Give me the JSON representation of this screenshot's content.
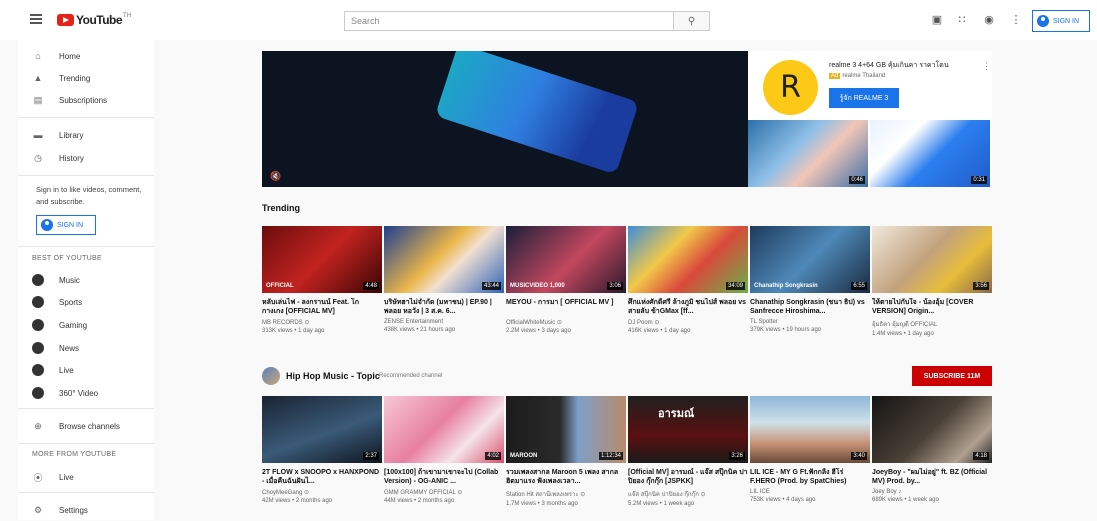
{
  "header": {
    "logo_text": "YouTube",
    "logo_sup": "TH",
    "search_placeholder": "Search",
    "sign_in": "SIGN IN"
  },
  "sidebar": {
    "items_top": [
      {
        "label": "Home",
        "icon": "home-icon"
      },
      {
        "label": "Trending",
        "icon": "flame-icon"
      },
      {
        "label": "Subscriptions",
        "icon": "subscriptions-icon"
      }
    ],
    "items_lib": [
      {
        "label": "Library",
        "icon": "folder-icon"
      },
      {
        "label": "History",
        "icon": "history-icon"
      }
    ],
    "signin_prompt": "Sign in to like videos, comment, and subscribe.",
    "signin_button": "SIGN IN",
    "best_heading": "BEST OF YOUTUBE",
    "best_items": [
      {
        "label": "Music",
        "icon": "music-icon"
      },
      {
        "label": "Sports",
        "icon": "sports-icon"
      },
      {
        "label": "Gaming",
        "icon": "gaming-icon"
      },
      {
        "label": "News",
        "icon": "news-icon"
      },
      {
        "label": "Live",
        "icon": "live-icon"
      },
      {
        "label": "360° Video",
        "icon": "360-icon"
      }
    ],
    "browse_channels": "Browse channels",
    "more_heading": "MORE FROM YOUTUBE",
    "more_items": [
      {
        "label": "Live",
        "icon": "broadcast-icon"
      },
      {
        "label": "Settings",
        "icon": "gear-icon"
      }
    ]
  },
  "ad": {
    "title": "realme 3 4+64 GB คุ้มเกินคา ราคาโดน",
    "badge": "Ad",
    "advertiser": "realme Thailand",
    "cta": "รู้จัก REALME 3",
    "thumb1_duration": "0:46",
    "thumb2_duration": "0:31"
  },
  "trending": {
    "title": "Trending",
    "videos": [
      {
        "title": "หลับเล่นไฟ - ลงกรานน์ Feat. โก กางเกง [OFFICIAL MV]",
        "channel": "MB RECORDS ⊙",
        "meta": "313K views • 1 day ago",
        "duration": "4:48",
        "label": "OFFICIAL"
      },
      {
        "title": "บริษัทฮาไม่จำกัด (มหาชน) | EP.90 | พลอย หอวัง | 3 ส.ค. 6...",
        "channel": "ZENSE Entertainment",
        "meta": "438K views • 21 hours ago",
        "duration": "43:44",
        "label": ""
      },
      {
        "title": "MEYOU - การมา [ OFFICIAL MV ]",
        "channel": "OfficialWhiteMusic ⊙",
        "meta": "2.2M views • 3 days ago",
        "duration": "3:06",
        "label": "MUSICVIDEO  1,000"
      },
      {
        "title": "ศึกแห่งศักดิ์ศรี ล้างภูมิ ชนไปส์ พลอย vs สายลับ ข้าGMax [ff...",
        "channel": "DJ Poom ⊙",
        "meta": "416K views • 1 day ago",
        "duration": "34:09",
        "label": ""
      },
      {
        "title": "Chanathip Songkrasin (ชนา ธิป) vs Sanfrecce Hiroshima...",
        "channel": "TL Spotter",
        "meta": "379K views • 19 hours ago",
        "duration": "6:55",
        "label": "Chanathip Songkrasin"
      },
      {
        "title": "ให้ตายไปกับใจ - น้องอุ้ม [COVER VERSION] Origin...",
        "channel": "อุ้มธิดา อุ้มญดี OFFICIAL",
        "meta": "1.4M views • 1 day ago",
        "duration": "3:56",
        "label": ""
      }
    ]
  },
  "channel_shelf": {
    "name": "Hip Hop Music - Topic",
    "recommended": "Recommended channel",
    "subscribe": "SUBSCRIBE  11M",
    "videos": [
      {
        "title": "2T FLOW x SNOOPO x HANXPOND - เมื่อคืนฉันฝันไ...",
        "channel": "ChoyMeeGang ⊙",
        "meta": "42M views • 2 months ago",
        "duration": "2:37",
        "label": ""
      },
      {
        "title": "[100x100] ถ้าเขามาเขาจะไป (Collab Version) - OG-ANIC ...",
        "channel": "GMM GRAMMY OFFICIAL ⊙",
        "meta": "44M views • 2 months ago",
        "duration": "4:02",
        "label": ""
      },
      {
        "title": "รวมเพลงสากล Maroon 5 เพลง สากลฮิตมาแรง ฟังเพลงเวลา...",
        "channel": "Station Hit สถานีเพลงเพราะ ⊙",
        "meta": "1.7M views • 3 months ago",
        "duration": "1:12:34",
        "label": "MAROON"
      },
      {
        "title": "[Official MV] อารมณ์ - แจ๊ส สปุ๊กนิค ปาปิยอง กุ๊กกุ๊ก [JSPKK]",
        "channel": "แจ๊ส สปุ๊กนิค ปาปิยอง กุ๊กกุ๊ก ⊙",
        "meta": "5.2M views • 1 week ago",
        "duration": "3:26",
        "label": "อารมณ์"
      },
      {
        "title": "LIL ICE - MY G Ft.ฟักกลิ้ง ฮีโร่ F.HERO (Prod. by SpatChies)",
        "channel": "LIL ICE",
        "meta": "753K views • 4 days ago",
        "duration": "3:40",
        "label": ""
      },
      {
        "title": "JoeyBoy - \"ผมไม่อยู่\" ft. BZ (Official MV) Prod. by...",
        "channel": "Joey Boy ♪",
        "meta": "689K views • 1 week ago",
        "duration": "4:18",
        "label": ""
      }
    ]
  }
}
